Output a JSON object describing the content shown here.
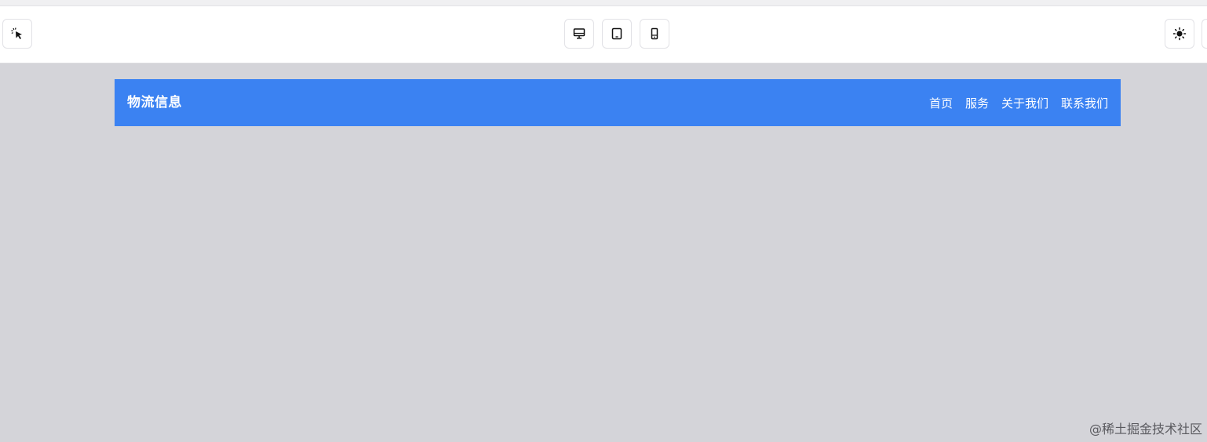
{
  "toolbar": {
    "inspect_icon": "pointer-select-icon",
    "devices": [
      {
        "name": "desktop",
        "icon": "monitor-icon"
      },
      {
        "name": "tablet",
        "icon": "tablet-icon"
      },
      {
        "name": "mobile",
        "icon": "phone-icon"
      }
    ],
    "theme_icon": "sun-icon"
  },
  "preview": {
    "navbar": {
      "brand": "物流信息",
      "links": [
        "首页",
        "服务",
        "关于我们",
        "联系我们"
      ],
      "color": "#3b82f2"
    },
    "background": "#d4d4d9"
  },
  "watermark": "@稀土掘金技术社区"
}
